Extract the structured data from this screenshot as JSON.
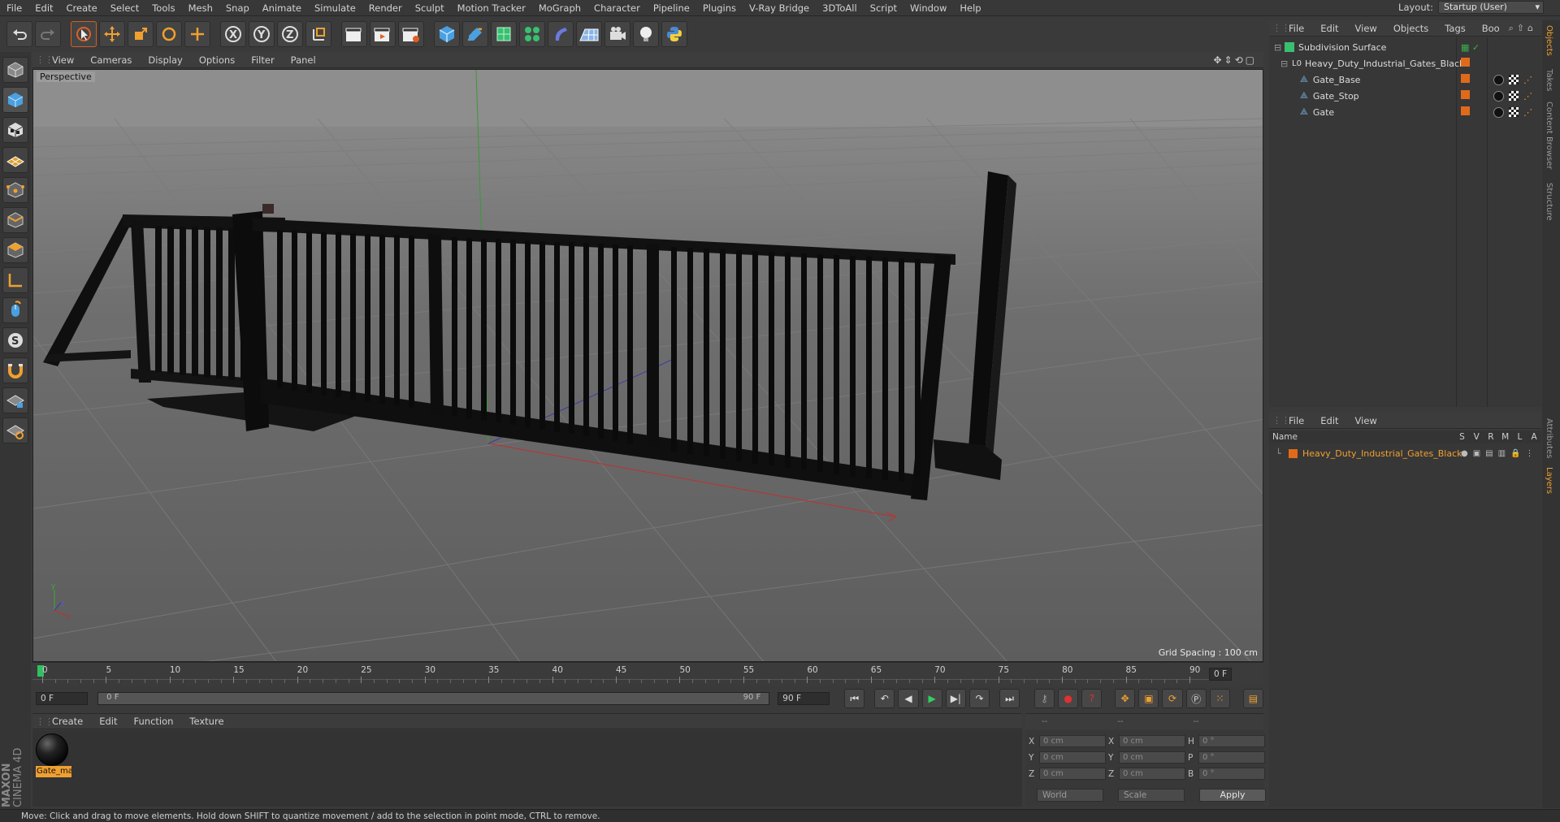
{
  "menubar": {
    "items": [
      "File",
      "Edit",
      "Create",
      "Select",
      "Tools",
      "Mesh",
      "Snap",
      "Animate",
      "Simulate",
      "Render",
      "Sculpt",
      "Motion Tracker",
      "MoGraph",
      "Character",
      "Pipeline",
      "Plugins",
      "V-Ray Bridge",
      "3DToAll",
      "Script",
      "Window",
      "Help"
    ],
    "layout_label": "Layout:",
    "layout_value": "Startup (User)"
  },
  "viewport": {
    "menu": [
      "View",
      "Cameras",
      "Display",
      "Options",
      "Filter",
      "Panel"
    ],
    "label": "Perspective",
    "grid_spacing": "Grid Spacing : 100 cm"
  },
  "timeline": {
    "ticks": [
      "0",
      "5",
      "10",
      "15",
      "20",
      "25",
      "30",
      "35",
      "40",
      "45",
      "50",
      "55",
      "60",
      "65",
      "70",
      "75",
      "80",
      "85",
      "90"
    ],
    "current_frame": "0 F",
    "start_field": "0 F",
    "range_start": "0 F",
    "range_end": "90 F",
    "end_field": "90 F"
  },
  "material_manager": {
    "menu": [
      "Create",
      "Edit",
      "Function",
      "Texture"
    ],
    "materials": [
      {
        "name": "Gate_ma"
      }
    ]
  },
  "coordinates": {
    "headers": [
      "--",
      "--",
      "--"
    ],
    "rows": [
      {
        "l1": "X",
        "v1": "0 cm",
        "l2": "X",
        "v2": "0 cm",
        "l3": "H",
        "v3": "0 °"
      },
      {
        "l1": "Y",
        "v1": "0 cm",
        "l2": "Y",
        "v2": "0 cm",
        "l3": "P",
        "v3": "0 °"
      },
      {
        "l1": "Z",
        "v1": "0 cm",
        "l2": "Z",
        "v2": "0 cm",
        "l3": "B",
        "v3": "0 °"
      }
    ],
    "space": "World",
    "mode": "Scale",
    "apply_label": "Apply"
  },
  "object_manager": {
    "menu": [
      "File",
      "Edit",
      "View",
      "Objects",
      "Tags",
      "Boo"
    ],
    "objects": [
      {
        "name": "Subdivision Surface",
        "indent": 0
      },
      {
        "name": "Heavy_Duty_Industrial_Gates_Black",
        "indent": 1
      },
      {
        "name": "Gate_Base",
        "indent": 2
      },
      {
        "name": "Gate_Stop",
        "indent": 2
      },
      {
        "name": "Gate",
        "indent": 2
      }
    ]
  },
  "layers_manager": {
    "menu": [
      "File",
      "Edit",
      "View"
    ],
    "columns": [
      "Name",
      "S",
      "V",
      "R",
      "M",
      "L",
      "A"
    ],
    "layers": [
      {
        "name": "Heavy_Duty_Industrial_Gates_Black"
      }
    ]
  },
  "side_tabs": [
    "Objects",
    "Takes",
    "Content Browser",
    "Structure",
    "Attributes",
    "Layers"
  ],
  "statusbar": {
    "text": "Move: Click and drag to move elements. Hold down SHIFT to quantize movement / add to the selection in point mode, CTRL to remove."
  },
  "logo": {
    "line1": "MAXON",
    "line2": "CINEMA 4D"
  },
  "colors": {
    "accent": "#f0a030",
    "layer_orange": "#e06a1a",
    "selection_orange": "#e8a020"
  }
}
